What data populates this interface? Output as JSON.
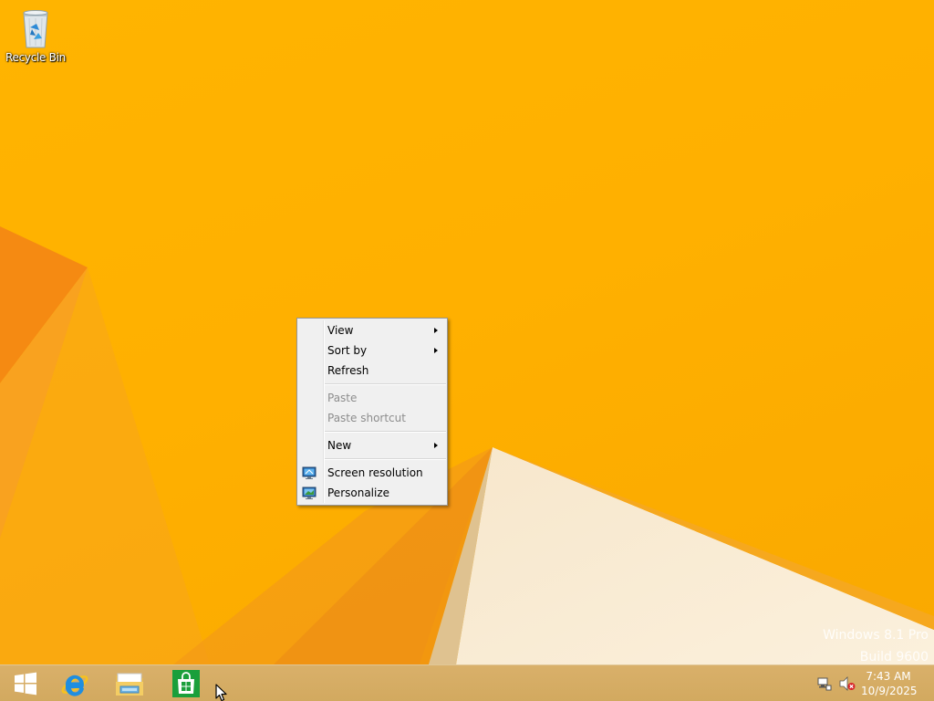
{
  "desktop": {
    "icons": [
      {
        "label": "Recycle Bin",
        "icon": "recycle-bin-icon"
      }
    ],
    "watermark": {
      "line1": "Windows 8.1 Pro",
      "line2": "Build 9600"
    },
    "colors": {
      "wallpaper": "#ffb400",
      "taskbar": "#d6ab62",
      "menu_background": "#f0f0f0",
      "disabled_text": "#8d8d8d"
    }
  },
  "context_menu": {
    "groups": [
      [
        {
          "label": "View",
          "submenu": true,
          "enabled": true
        },
        {
          "label": "Sort by",
          "submenu": true,
          "enabled": true
        },
        {
          "label": "Refresh",
          "submenu": false,
          "enabled": true
        }
      ],
      [
        {
          "label": "Paste",
          "submenu": false,
          "enabled": false
        },
        {
          "label": "Paste shortcut",
          "submenu": false,
          "enabled": false
        }
      ],
      [
        {
          "label": "New",
          "submenu": true,
          "enabled": true
        }
      ],
      [
        {
          "label": "Screen resolution",
          "submenu": false,
          "enabled": true,
          "icon": "display-settings-icon"
        },
        {
          "label": "Personalize",
          "submenu": false,
          "enabled": true,
          "icon": "personalize-icon"
        }
      ]
    ]
  },
  "taskbar": {
    "start": {
      "icon": "windows-logo-icon"
    },
    "pinned": [
      {
        "name": "internet-explorer",
        "icon": "internet-explorer-icon"
      },
      {
        "name": "file-explorer",
        "icon": "file-explorer-icon"
      },
      {
        "name": "store",
        "icon": "store-icon"
      }
    ],
    "tray": {
      "icons": [
        "network-icon",
        "volume-muted-icon"
      ],
      "time": "7:43 AM",
      "date": "10/9/2025"
    }
  }
}
